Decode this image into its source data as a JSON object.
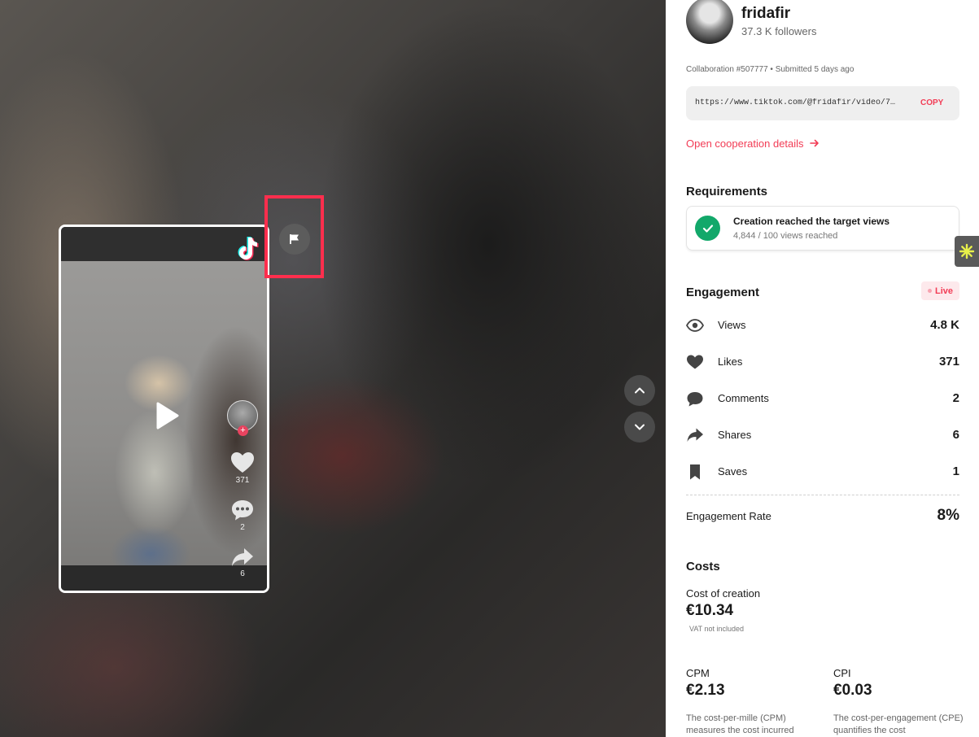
{
  "creator": {
    "username": "fridafir",
    "followers": "37.3 K followers"
  },
  "collaboration": {
    "meta": "Collaboration #507777 • Submitted 5 days ago",
    "url": "https://www.tiktok.com/@fridafir/video/755…",
    "copy_label": "COPY",
    "open_details": "Open cooperation details"
  },
  "requirements": {
    "title": "Requirements",
    "item_title": "Creation reached the target views",
    "item_sub": "4,844 / 100 views reached"
  },
  "engagement": {
    "title": "Engagement",
    "badge": "Live",
    "metrics": [
      {
        "label": "Views",
        "value": "4.8 K",
        "icon": "eye-icon"
      },
      {
        "label": "Likes",
        "value": "371",
        "icon": "heart-icon"
      },
      {
        "label": "Comments",
        "value": "2",
        "icon": "comment-icon"
      },
      {
        "label": "Shares",
        "value": "6",
        "icon": "share-icon"
      },
      {
        "label": "Saves",
        "value": "1",
        "icon": "bookmark-icon"
      }
    ],
    "rate_label": "Engagement Rate",
    "rate_value": "8%"
  },
  "costs": {
    "title": "Costs",
    "creation_label": "Cost of creation",
    "creation_value": "€10.34",
    "vat": "VAT not included",
    "cpm_label": "CPM",
    "cpm_value": "€2.13",
    "cpm_desc": "The cost-per-mille (CPM) measures the cost incurred",
    "cpi_label": "CPI",
    "cpi_value": "€0.03",
    "cpi_desc": "The cost-per-engagement (CPE) quantifies the cost"
  },
  "video": {
    "likes": "371",
    "comments": "2",
    "shares": "6"
  },
  "colors": {
    "accent": "#f23c55",
    "success": "#12a86a",
    "highlight": "#ff2e4d"
  }
}
